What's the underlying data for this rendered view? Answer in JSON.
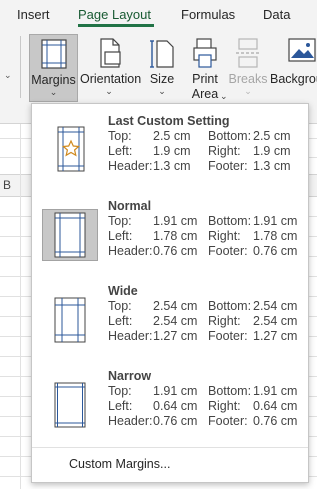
{
  "tabs": [
    {
      "label": "Insert"
    },
    {
      "label": "Page Layout",
      "active": true
    },
    {
      "label": "Formulas"
    },
    {
      "label": "Data"
    }
  ],
  "ribbon": {
    "margins": {
      "label": "Margins",
      "icon": "margins-icon"
    },
    "orientation": {
      "label": "Orientation",
      "icon": "orientation-icon"
    },
    "size": {
      "label": "Size",
      "icon": "size-icon"
    },
    "print_area": {
      "label_line1": "Print",
      "label_line2": "Area",
      "icon": "print-area-icon"
    },
    "breaks": {
      "label": "Breaks",
      "icon": "breaks-icon",
      "disabled": true
    },
    "background": {
      "label": "Backgrou",
      "icon": "background-icon"
    }
  },
  "sheet": {
    "column_label": "B"
  },
  "margins_menu": {
    "options": [
      {
        "title": "Last Custom Setting",
        "top_label": "Top:",
        "top": "2.5 cm",
        "bottom_label": "Bottom:",
        "bottom": "2.5 cm",
        "left_label": "Left:",
        "left": "1.9 cm",
        "right_label": "Right:",
        "right": "1.9 cm",
        "header_label": "Header:",
        "header": "1.3 cm",
        "footer_label": "Footer:",
        "footer": "1.3 cm",
        "icon": "custom-margins-star-icon"
      },
      {
        "title": "Normal",
        "top_label": "Top:",
        "top": "1.91 cm",
        "bottom_label": "Bottom:",
        "bottom": "1.91 cm",
        "left_label": "Left:",
        "left": "1.78 cm",
        "right_label": "Right:",
        "right": "1.78 cm",
        "header_label": "Header:",
        "header": "0.76 cm",
        "footer_label": "Footer:",
        "footer": "0.76 cm",
        "icon": "normal-margins-icon",
        "selected": true
      },
      {
        "title": "Wide",
        "top_label": "Top:",
        "top": "2.54 cm",
        "bottom_label": "Bottom:",
        "bottom": "2.54 cm",
        "left_label": "Left:",
        "left": "2.54 cm",
        "right_label": "Right:",
        "right": "2.54 cm",
        "header_label": "Header:",
        "header": "1.27 cm",
        "footer_label": "Footer:",
        "footer": "1.27 cm",
        "icon": "wide-margins-icon"
      },
      {
        "title": "Narrow",
        "top_label": "Top:",
        "top": "1.91 cm",
        "bottom_label": "Bottom:",
        "bottom": "1.91 cm",
        "left_label": "Left:",
        "left": "0.64 cm",
        "right_label": "Right:",
        "right": "0.64 cm",
        "header_label": "Header:",
        "header": "0.76 cm",
        "footer_label": "Footer:",
        "footer": "0.76 cm",
        "icon": "narrow-margins-icon"
      }
    ],
    "custom_label": "Custom Margins..."
  },
  "colors": {
    "accent": "#217346",
    "selected_bg": "#c8c8c8",
    "guide_blue": "#2b579a"
  }
}
